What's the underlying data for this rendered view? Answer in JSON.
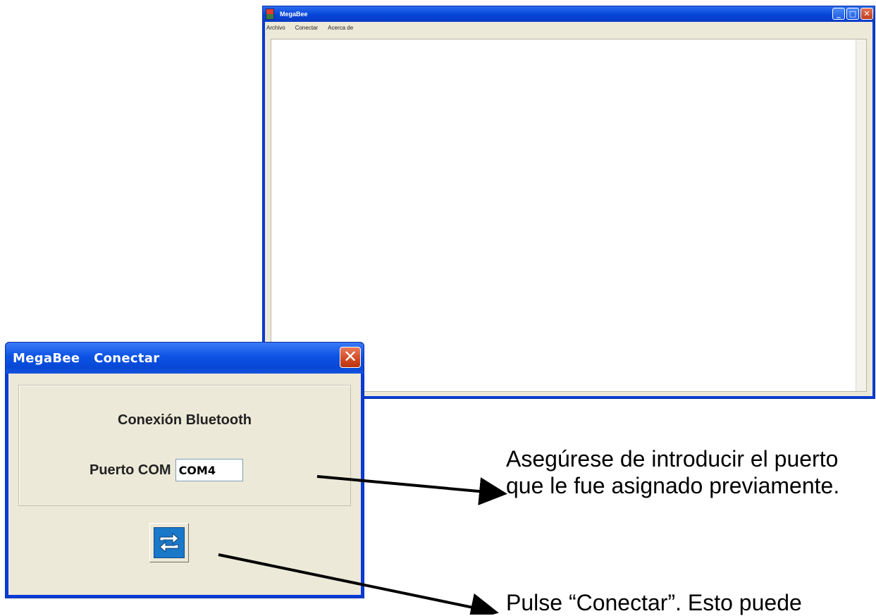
{
  "main_window": {
    "title": "MegaBee",
    "menu": [
      "Archivo",
      "Conectar",
      "Acerca de"
    ]
  },
  "dialog": {
    "title": "MegaBee   Conectar",
    "heading": "Conexión Bluetooth",
    "port_label": "Puerto COM",
    "port_value": "COM4"
  },
  "annotations": {
    "note_1": "Asegúrese de introducir el puerto que le fue asignado previamente.",
    "note_2": "Pulse “Conectar”. Esto puede"
  },
  "colors": {
    "titlebar_blue": "#0a3bd6",
    "dialog_face": "#ece9d8",
    "close_red": "#d24a22",
    "icon_blue": "#1a78c8"
  }
}
